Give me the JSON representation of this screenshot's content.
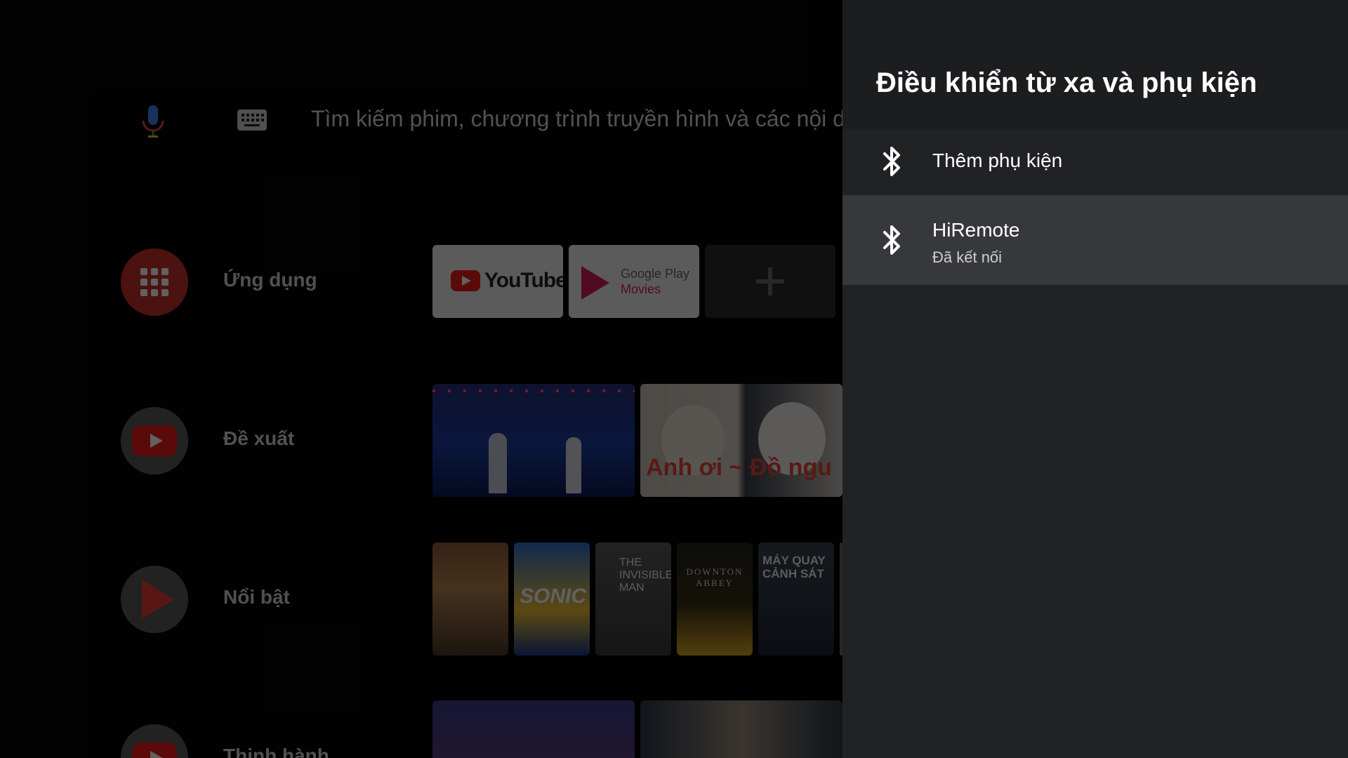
{
  "search": {
    "placeholder": "Tìm kiếm phim, chương trình truyền hình và các nội du"
  },
  "rows": [
    {
      "label": "Ứng dụng",
      "icon": "apps-grid-icon"
    },
    {
      "label": "Đề xuất",
      "icon": "youtube-icon"
    },
    {
      "label": "Nổi bật",
      "icon": "play-movies-icon"
    },
    {
      "label": "Thịnh hành",
      "icon": "youtube-icon"
    }
  ],
  "apps": [
    {
      "name": "YouTube",
      "logo_text": "YouTube"
    },
    {
      "name": "Google Play Movies",
      "line1": "Google Play",
      "line2": "Movies"
    },
    {
      "name": "add-app",
      "icon": "plus-icon"
    }
  ],
  "video_thumbnails": [
    {
      "caption": ""
    },
    {
      "caption": "Anh ơi ~ Đồ ngu"
    }
  ],
  "posters": [
    {
      "title": ""
    },
    {
      "title": "SONIC"
    },
    {
      "title": "THE INVISIBLE MAN"
    },
    {
      "title": "DOWNTON ABBEY"
    },
    {
      "title": "MÁY QUAY CẢNH SÁT"
    }
  ],
  "panel": {
    "title": "Điều khiển từ xa và phụ kiện",
    "items": [
      {
        "label": "Thêm phụ kiện",
        "icon": "bluetooth-icon"
      },
      {
        "label": "HiRemote",
        "subtitle": "Đã kết nối",
        "icon": "bluetooth-icon",
        "selected": true
      }
    ]
  },
  "colors": {
    "panel_bg": "#212224",
    "panel_header_bg": "#1c1d1f",
    "selected_item_bg": "#37383b",
    "apps_red": "#c9302c",
    "youtube_red": "#ee1c1b"
  }
}
